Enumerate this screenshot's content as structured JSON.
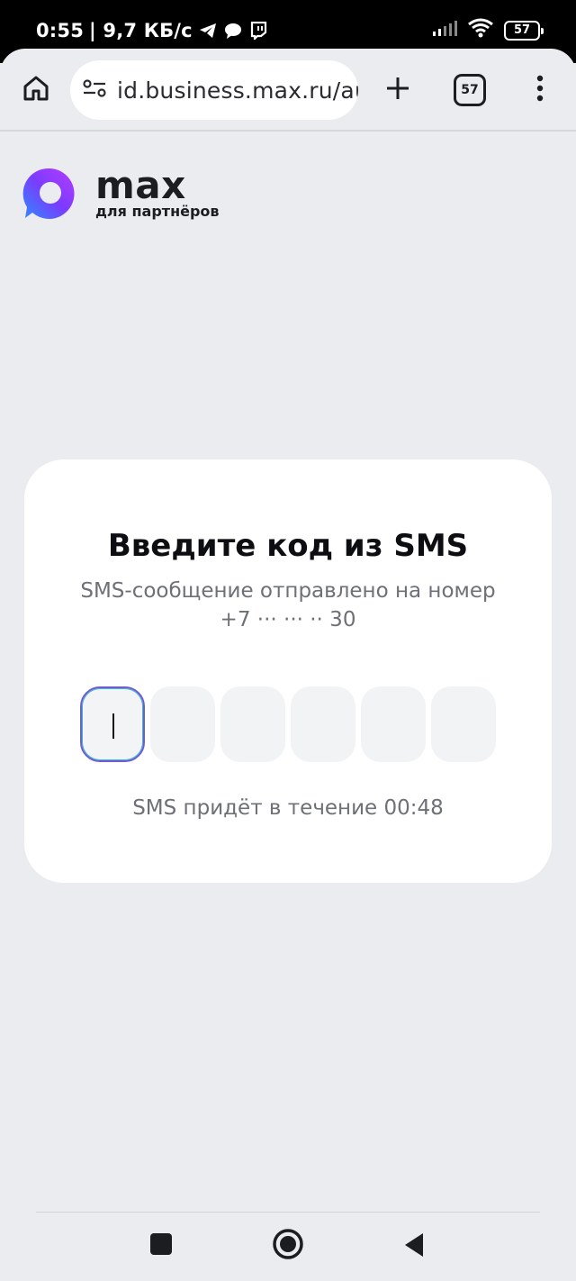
{
  "status_bar": {
    "time": "0:55",
    "speed": "| 9,7 КБ/с",
    "battery": "57",
    "icons": [
      "telegram-icon",
      "chat-icon",
      "twitch-icon",
      "signal-icon",
      "wifi-icon",
      "battery-icon"
    ]
  },
  "browser": {
    "url": "id.business.max.ru/auth",
    "tab_count": "57",
    "icons": [
      "home-icon",
      "site-settings-icon",
      "plus-icon",
      "tabs-icon",
      "more-icon"
    ]
  },
  "logo": {
    "word": "max",
    "subtitle": "для партнёров"
  },
  "card": {
    "title": "Введите код из SMS",
    "subtitle_line1": "SMS-сообщение отправлено на номер",
    "subtitle_line2": "+7 ··· ··· ·· 30",
    "timer": "SMS придёт в течение 00:48",
    "code_digits": [
      "",
      "",
      "",
      "",
      "",
      ""
    ]
  },
  "colors": {
    "page_bg": "#ebecf0",
    "card_bg": "#ffffff",
    "code_box_bg": "#f2f3f5",
    "active_border": "#6d5cd6",
    "text_primary": "#0d0e12",
    "text_secondary": "#6e7077"
  }
}
